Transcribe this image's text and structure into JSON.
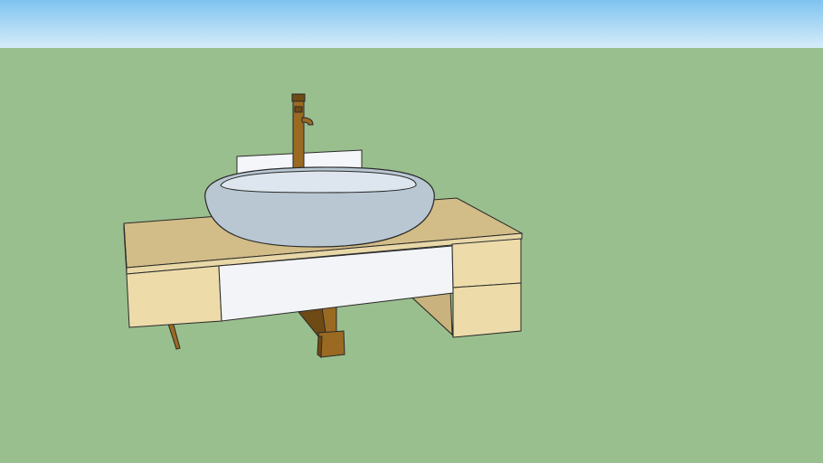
{
  "scene": {
    "colors": {
      "sky_top": "#7ec3f0",
      "sky_bottom": "#d6ecf8",
      "ground": "#9abf8e",
      "countertop": "#d2bc87",
      "countertop_edge": "#e8d8a8",
      "cabinet_front": "#eddcaa",
      "cabinet_side": "#c9b27d",
      "drawer_white": "#f3f4f8",
      "basin_outer": "#b9c7d3",
      "basin_inner": "#dde6ee",
      "backsplash": "#f4f6f9",
      "pipe_bronze": "#9a6a22",
      "pipe_dark": "#6e4a14",
      "outline": "#2a2a2a"
    }
  }
}
